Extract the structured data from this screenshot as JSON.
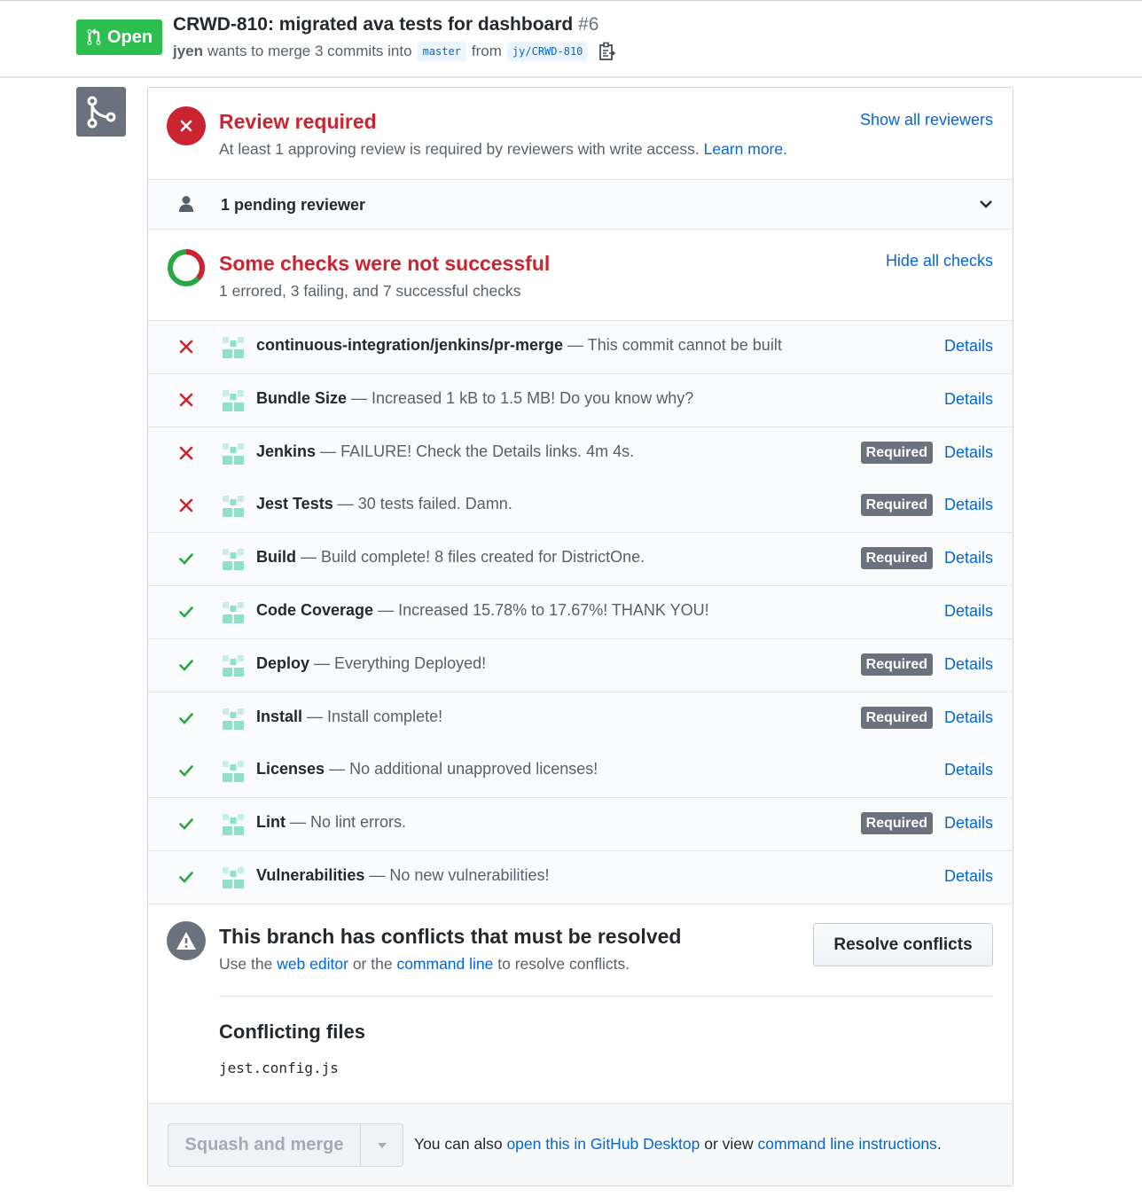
{
  "pr": {
    "state": "Open",
    "title": "CRWD-810: migrated ava tests for dashboard",
    "number": "#6",
    "author": "jyen",
    "merge_text": "wants to merge 3 commits into",
    "base_branch": "master",
    "from_text": "from",
    "head_branch": "jy/CRWD-810"
  },
  "review": {
    "title": "Review required",
    "subtitle": "At least 1 approving review is required by reviewers with write access.",
    "learn_more": "Learn more.",
    "show_all": "Show all reviewers",
    "pending": "1 pending reviewer"
  },
  "checks_summary": {
    "title": "Some checks were not successful",
    "subtitle": "1 errored, 3 failing, and 7 successful checks",
    "hide_all": "Hide all checks"
  },
  "checks": [
    {
      "status": "fail",
      "name": "continuous-integration/jenkins/pr-merge",
      "desc": "— This commit cannot be built",
      "required": false,
      "details": "Details"
    },
    {
      "status": "fail",
      "name": "Bundle Size",
      "desc": "— Increased 1 kB to 1.5 MB! Do you know why?",
      "required": false,
      "details": "Details"
    },
    {
      "status": "fail",
      "name": "Jenkins",
      "desc": "— FAILURE! Check the Details links. 4m 4s.",
      "required": true,
      "details": "Details"
    },
    {
      "status": "fail",
      "name": "Jest Tests",
      "desc": "— 30 tests failed. Damn.",
      "required": true,
      "details": "Details"
    },
    {
      "status": "pass",
      "name": "Build",
      "desc": "— Build complete! 8 files created for DistrictOne.",
      "required": true,
      "details": "Details"
    },
    {
      "status": "pass",
      "name": "Code Coverage",
      "desc": "— Increased 15.78% to 17.67%! THANK YOU!",
      "required": false,
      "details": "Details"
    },
    {
      "status": "pass",
      "name": "Deploy",
      "desc": "— Everything Deployed!",
      "required": true,
      "details": "Details"
    },
    {
      "status": "pass",
      "name": "Install",
      "desc": "— Install complete!",
      "required": true,
      "details": "Details"
    },
    {
      "status": "pass",
      "name": "Licenses",
      "desc": "— No additional unapproved licenses!",
      "required": false,
      "details": "Details"
    },
    {
      "status": "pass",
      "name": "Lint",
      "desc": "— No lint errors.",
      "required": true,
      "details": "Details"
    },
    {
      "status": "pass",
      "name": "Vulnerabilities",
      "desc": "— No new vulnerabilities!",
      "required": false,
      "details": "Details"
    }
  ],
  "required_label": "Required",
  "conflicts": {
    "title": "This branch has conflicts that must be resolved",
    "use_the": "Use the",
    "web_editor": "web editor",
    "or_the": "or the",
    "command_line": "command line",
    "to_resolve": "to resolve conflicts.",
    "resolve_button": "Resolve conflicts",
    "files_title": "Conflicting files",
    "files": [
      "jest.config.js"
    ]
  },
  "merge": {
    "button": "Squash and merge",
    "also": "You can also",
    "open_desktop": "open this in GitHub Desktop",
    "or_view": "or view",
    "cli_instructions": "command line instructions",
    "period": "."
  },
  "colors": {
    "open_green": "#2cbe4e",
    "error_red": "#cb2431",
    "success_green": "#28a745",
    "link_blue": "#0366d6",
    "badge_gray": "#6a737d"
  }
}
